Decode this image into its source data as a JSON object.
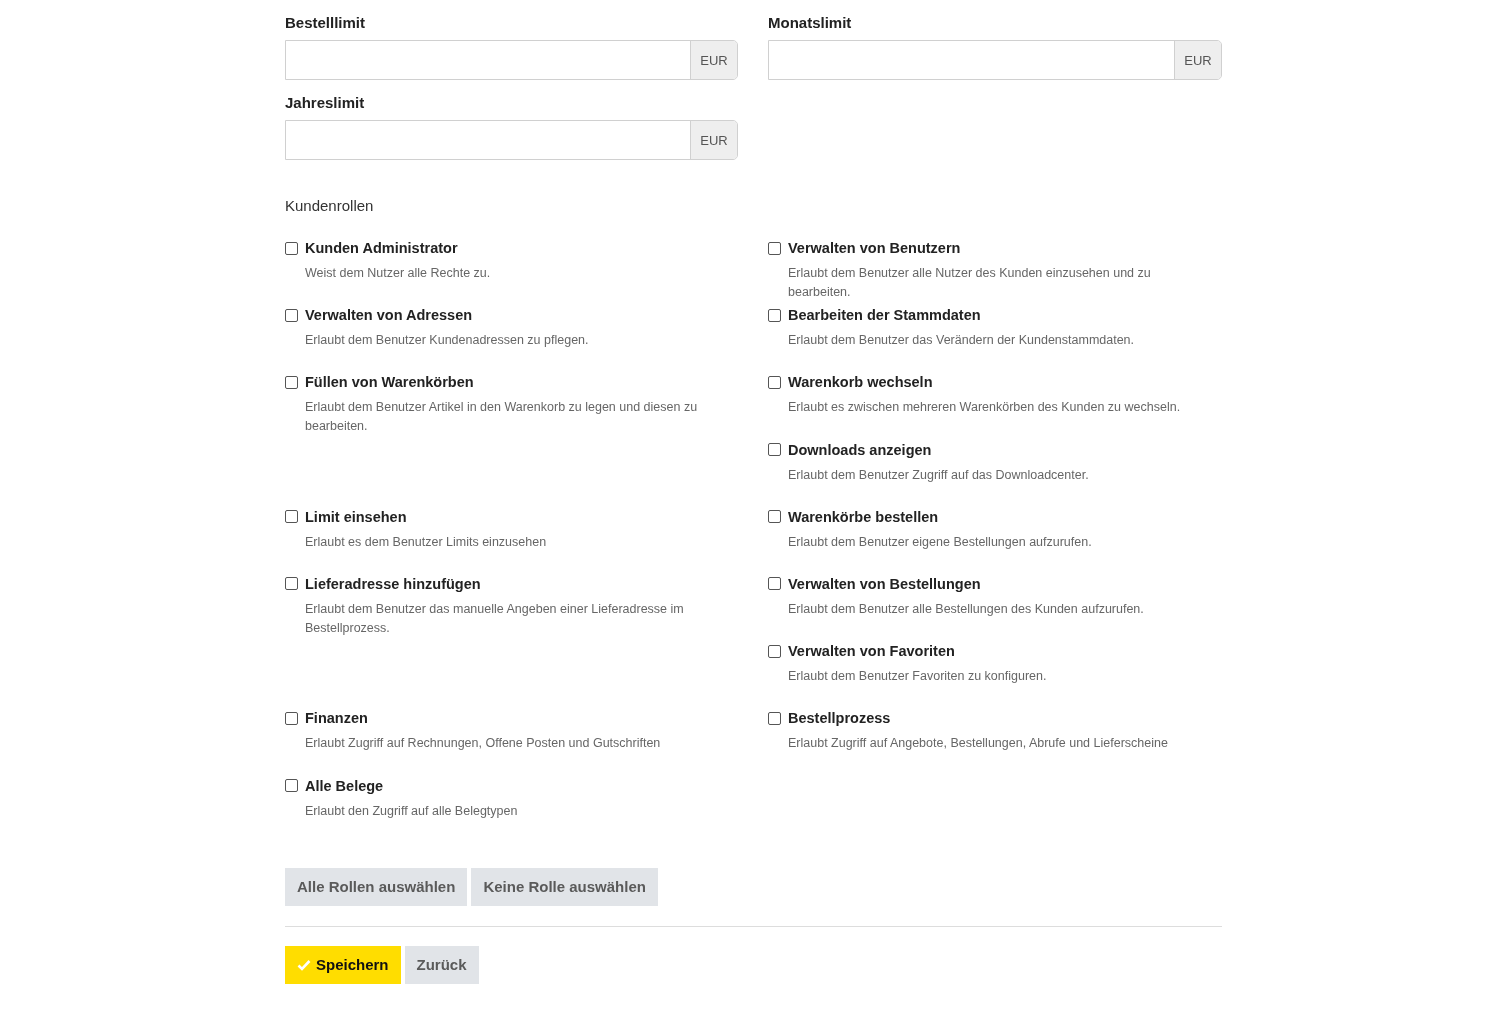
{
  "limits": [
    {
      "label": "Bestelllimit",
      "unit": "EUR"
    },
    {
      "label": "Monatslimit",
      "unit": "EUR"
    },
    {
      "label": "Jahreslimit",
      "unit": "EUR"
    }
  ],
  "roles_heading": "Kundenrollen",
  "role_rows": [
    {
      "left": {
        "title": "Kunden Administrator",
        "description": "Weist dem Nutzer alle Rechte zu.",
        "checked": false
      },
      "right": {
        "title": "Verwalten von Benutzern",
        "description": "Erlaubt dem Benutzer alle Nutzer des Kunden einzusehen und zu bearbeiten.",
        "checked": false
      }
    },
    {
      "left": {
        "title": "Verwalten von Adressen",
        "description": "Erlaubt dem Benutzer Kundenadressen zu pflegen.",
        "checked": false
      },
      "right": {
        "title": "Bearbeiten der Stammdaten",
        "description": "Erlaubt dem Benutzer das Verändern der Kundenstammdaten.",
        "checked": false
      }
    },
    {
      "left": {
        "title": "Füllen von Warenkörben",
        "description": "Erlaubt dem Benutzer Artikel in den Warenkorb zu legen und diesen zu bearbeiten.",
        "checked": false
      },
      "right": {
        "title": "Warenkorb wechseln",
        "description": "Erlaubt es zwischen mehreren Warenkörben des Kunden zu wechseln.",
        "checked": false
      }
    },
    {
      "right": {
        "title": "Downloads anzeigen",
        "description": "Erlaubt dem Benutzer Zugriff auf das Downloadcenter.",
        "checked": false
      }
    },
    {
      "left": {
        "title": "Limit einsehen",
        "description": "Erlaubt es dem Benutzer Limits einzusehen",
        "checked": false
      },
      "right": {
        "title": "Warenkörbe bestellen",
        "description": "Erlaubt dem Benutzer eigene Bestellungen aufzurufen.",
        "checked": false
      }
    },
    {
      "left": {
        "title": "Lieferadresse hinzufügen",
        "description": "Erlaubt dem Benutzer das manuelle Angeben einer Lieferadresse im Bestellprozess.",
        "checked": false
      },
      "right": {
        "title": "Verwalten von Bestellungen",
        "description": "Erlaubt dem Benutzer alle Bestellungen des Kunden aufzurufen.",
        "checked": false
      }
    },
    {
      "right": {
        "title": "Verwalten von Favoriten",
        "description": "Erlaubt dem Benutzer Favoriten zu konfiguren.",
        "checked": false
      }
    },
    {
      "left": {
        "title": "Finanzen",
        "description": "Erlaubt Zugriff auf Rechnungen, Offene Posten und Gutschriften",
        "checked": false
      },
      "right": {
        "title": "Bestellprozess",
        "description": "Erlaubt Zugriff auf Angebote, Bestellungen, Abrufe und Lieferscheine",
        "checked": false
      }
    },
    {
      "left": {
        "title": "Alle Belege",
        "description": "Erlaubt den Zugriff auf alle Belegtypen",
        "checked": false
      }
    }
  ],
  "role_buttons": [
    {
      "label": "Alle Rollen auswählen",
      "kind": "secondary"
    },
    {
      "label": "Keine Rolle auswählen",
      "kind": "secondary"
    }
  ],
  "form_buttons": [
    {
      "label": "Speichern",
      "kind": "primary"
    },
    {
      "label": "Zurück",
      "kind": "secondary"
    }
  ]
}
